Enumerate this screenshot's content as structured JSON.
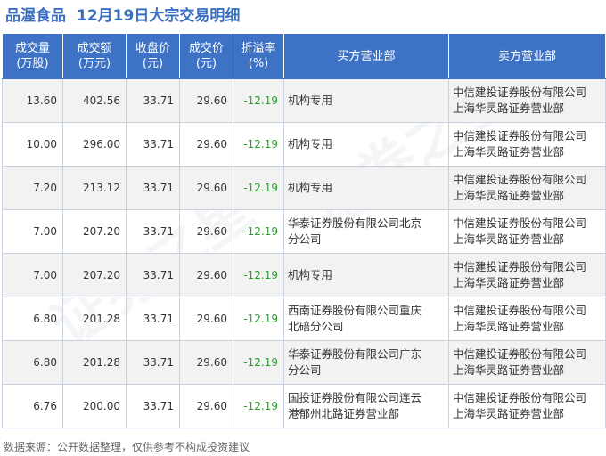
{
  "title": {
    "stock": "品渥食品",
    "subtitle": "12月19日大宗交易明细"
  },
  "headers": {
    "volume": [
      "成交量",
      "(万股)"
    ],
    "amount": [
      "成交额",
      "(万元)"
    ],
    "close": [
      "收盘价",
      "(元)"
    ],
    "price": [
      "成交价",
      "(元)"
    ],
    "premium": [
      "折溢率",
      "(%)"
    ],
    "buyer": "买方营业部",
    "seller": "卖方营业部"
  },
  "rows": [
    {
      "volume": "13.60",
      "amount": "402.56",
      "close": "33.71",
      "price": "29.60",
      "premium": "-12.19",
      "buyer": [
        "机构专用"
      ],
      "seller": [
        "中信建投证券股份有限公司",
        "上海华灵路证券营业部"
      ]
    },
    {
      "volume": "10.00",
      "amount": "296.00",
      "close": "33.71",
      "price": "29.60",
      "premium": "-12.19",
      "buyer": [
        "机构专用"
      ],
      "seller": [
        "中信建投证券股份有限公司",
        "上海华灵路证券营业部"
      ]
    },
    {
      "volume": "7.20",
      "amount": "213.12",
      "close": "33.71",
      "price": "29.60",
      "premium": "-12.19",
      "buyer": [
        "机构专用"
      ],
      "seller": [
        "中信建投证券股份有限公司",
        "上海华灵路证券营业部"
      ]
    },
    {
      "volume": "7.00",
      "amount": "207.20",
      "close": "33.71",
      "price": "29.60",
      "premium": "-12.19",
      "buyer": [
        "华泰证券股份有限公司北京",
        "分公司"
      ],
      "seller": [
        "中信建投证券股份有限公司",
        "上海华灵路证券营业部"
      ]
    },
    {
      "volume": "7.00",
      "amount": "207.20",
      "close": "33.71",
      "price": "29.60",
      "premium": "-12.19",
      "buyer": [
        "机构专用"
      ],
      "seller": [
        "中信建投证券股份有限公司",
        "上海华灵路证券营业部"
      ]
    },
    {
      "volume": "6.80",
      "amount": "201.28",
      "close": "33.71",
      "price": "29.60",
      "premium": "-12.19",
      "buyer": [
        "西南证券股份有限公司重庆",
        "北碚分公司"
      ],
      "seller": [
        "中信建投证券股份有限公司",
        "上海华灵路证券营业部"
      ]
    },
    {
      "volume": "6.80",
      "amount": "201.28",
      "close": "33.71",
      "price": "29.60",
      "premium": "-12.19",
      "buyer": [
        "华泰证券股份有限公司广东",
        "分公司"
      ],
      "seller": [
        "中信建投证券股份有限公司",
        "上海华灵路证券营业部"
      ]
    },
    {
      "volume": "6.76",
      "amount": "200.00",
      "close": "33.71",
      "price": "29.60",
      "premium": "-12.19",
      "buyer": [
        "国投证券股份有限公司连云",
        "港郁州北路证券营业部"
      ],
      "seller": [
        "中信建投证券股份有限公司",
        "上海华灵路证券营业部"
      ]
    }
  ],
  "footer": "数据来源：公开数据整理，仅供参考不构成投资建议",
  "watermark": "证券之星",
  "colors": {
    "header_bg": "#3e72c4",
    "title": "#3a6fbf",
    "premium": "#2e9b2e",
    "alt_row": "#f2f2f2"
  }
}
